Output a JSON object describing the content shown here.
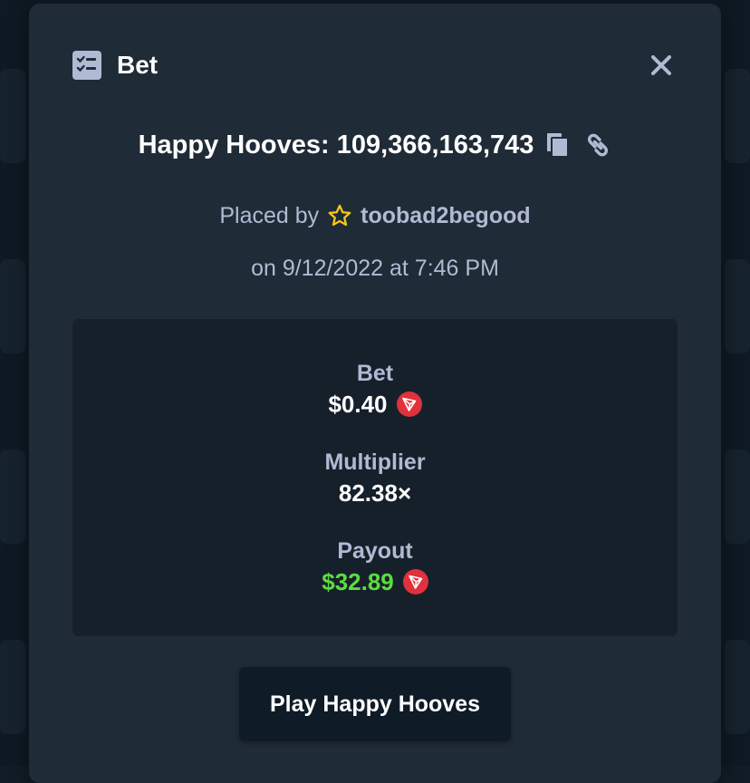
{
  "header": {
    "title": "Bet",
    "icon": "checklist-icon",
    "close_icon": "close-icon"
  },
  "game": {
    "label": "Happy Hooves: 109,366,163,743",
    "copy_icon": "copy-icon",
    "link_icon": "link-icon"
  },
  "placed": {
    "prefix": "Placed by",
    "badge_icon": "star-icon",
    "username": "toobad2begood",
    "date": "on 9/12/2022 at 7:46 PM"
  },
  "stats": {
    "bet_label": "Bet",
    "bet_value": "$0.40",
    "multiplier_label": "Multiplier",
    "multiplier_value": "82.38×",
    "payout_label": "Payout",
    "payout_value": "$32.89",
    "currency_icon": "tron-icon"
  },
  "actions": {
    "play_label": "Play Happy Hooves"
  },
  "colors": {
    "modal_bg": "#1f2b36",
    "stats_bg": "#16202b",
    "text_muted": "#b1bad3",
    "payout_green": "#5ddc3f",
    "tron_red": "#e0313c",
    "star_yellow": "#f5c518"
  }
}
